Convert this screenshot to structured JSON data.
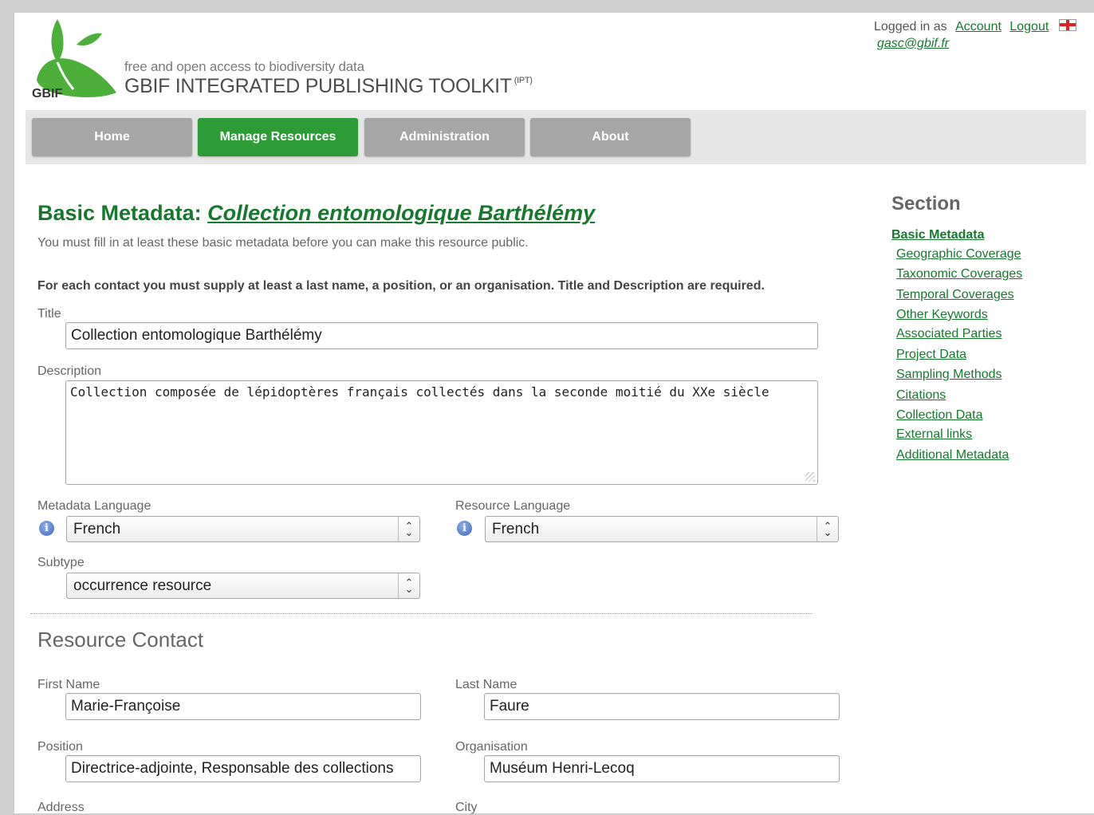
{
  "header": {
    "logo_text": "GBIF",
    "tagline": "free and open access to biodiversity data",
    "brand": "GBIF INTEGRATED PUBLISHING TOOLKIT",
    "brand_sup": "(IPT)",
    "logged_in_as": "Logged in as",
    "account_link": "Account",
    "logout_link": "Logout",
    "email": "gasc@gbif.fr"
  },
  "nav": {
    "items": [
      "Home",
      "Manage Resources",
      "Administration",
      "About"
    ],
    "active": "Manage Resources"
  },
  "main": {
    "title_prefix": "Basic Metadata:",
    "title_resource": "Collection entomologique Barthélémy",
    "intro": "You must fill in at least these basic metadata before you can make this resource public.",
    "notice": "For each contact you must supply at least a last name, a position, or an organisation. Title and Description are required.",
    "title_label": "Title",
    "title_value": "Collection entomologique Barthélémy",
    "description_label": "Description",
    "description_value": "Collection composée de lépidoptères français collectés dans la seconde moitié du XXe siècle",
    "metadata_language_label": "Metadata Language",
    "metadata_language_value": "French",
    "resource_language_label": "Resource Language",
    "resource_language_value": "French",
    "subtype_label": "Subtype",
    "subtype_value": "occurrence resource",
    "contact_heading": "Resource Contact",
    "first_name_label": "First Name",
    "first_name_value": "Marie-Françoise",
    "last_name_label": "Last Name",
    "last_name_value": "Faure",
    "position_label": "Position",
    "position_value": "Directrice-adjointe, Responsable des collections",
    "organisation_label": "Organisation",
    "organisation_value": "Muséum Henri-Lecoq",
    "address_label": "Address",
    "city_label": "City"
  },
  "sidebar": {
    "title": "Section",
    "items": [
      "Basic Metadata",
      "Geographic Coverage",
      "Taxonomic Coverages",
      "Temporal Coverages",
      "Other Keywords",
      "Associated Parties",
      "Project Data",
      "Sampling Methods",
      "Citations",
      "Collection Data",
      "External links",
      "Additional Metadata"
    ],
    "current": "Basic Metadata"
  },
  "colors": {
    "brand_green": "#16782d",
    "nav_active": "#2e9c36",
    "nav_inactive": "#a6a6a6"
  }
}
